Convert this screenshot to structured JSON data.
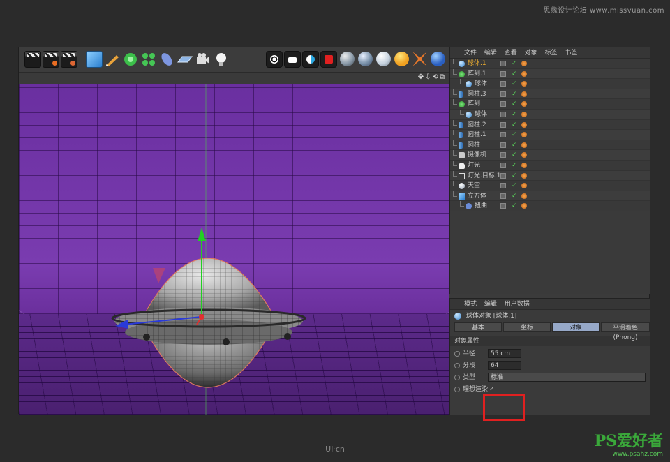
{
  "watermark_top": "思缘设计论坛 www.missvuan.com",
  "watermark_bottom": "UI·cn",
  "watermark_ps": "PS爱好者",
  "watermark_ps_url": "www.psahz.com",
  "colors": {
    "accent_selected": "#f0b030",
    "tab_active": "#96a8c8",
    "highlight_box": "#e02020",
    "viewport_purple": "#7a3cb0"
  },
  "object_manager": {
    "menu": [
      "文件",
      "编辑",
      "查看",
      "对象",
      "标签",
      "书签"
    ],
    "items": [
      {
        "name": "球体.1",
        "icon": "sphere-icon",
        "indent": 0,
        "selected": true
      },
      {
        "name": "阵列.1",
        "icon": "array-icon",
        "indent": 0,
        "selected": false
      },
      {
        "name": "球体",
        "icon": "sphere-icon",
        "indent": 1,
        "selected": false
      },
      {
        "name": "圆柱.3",
        "icon": "cylinder-icon",
        "indent": 0,
        "selected": false
      },
      {
        "name": "阵列",
        "icon": "array-icon",
        "indent": 0,
        "selected": false
      },
      {
        "name": "球体",
        "icon": "sphere-icon",
        "indent": 1,
        "selected": false
      },
      {
        "name": "圆柱.2",
        "icon": "cylinder-icon",
        "indent": 0,
        "selected": false
      },
      {
        "name": "圆柱.1",
        "icon": "cylinder-icon",
        "indent": 0,
        "selected": false
      },
      {
        "name": "圆柱",
        "icon": "cylinder-icon",
        "indent": 0,
        "selected": false
      },
      {
        "name": "摄像机",
        "icon": "camera-icon",
        "indent": 0,
        "selected": false
      },
      {
        "name": "灯光",
        "icon": "light-icon",
        "indent": 0,
        "selected": false
      },
      {
        "name": "灯光.目标.1",
        "icon": "light-target-icon",
        "indent": 0,
        "selected": false
      },
      {
        "name": "天空",
        "icon": "sky-icon",
        "indent": 0,
        "selected": false
      },
      {
        "name": "立方体",
        "icon": "cube-icon",
        "indent": 0,
        "selected": false
      },
      {
        "name": "扭曲",
        "icon": "bend-icon",
        "indent": 1,
        "selected": false
      }
    ]
  },
  "attributes": {
    "menu": [
      "模式",
      "编辑",
      "用户数据"
    ],
    "object_title": "球体对象 [球体.1]",
    "tabs": [
      "基本",
      "坐标",
      "对象",
      "平滑着色(Phong)"
    ],
    "active_tab": 2,
    "section_title": "对象属性",
    "fields": {
      "radius_label": "半径",
      "radius_value": "55 cm",
      "segments_label": "分段",
      "segments_value": "64",
      "type_label": "类型",
      "type_value": "标准",
      "render_label": "理想渲染",
      "render_checked": "✓"
    }
  }
}
